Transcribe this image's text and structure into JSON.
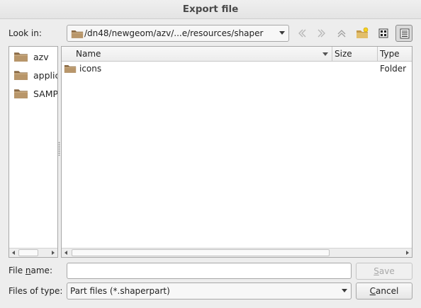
{
  "window": {
    "title": "Export file"
  },
  "look_in": {
    "label": "Look in:",
    "path": "/dn48/newgeom/azv/...e/resources/shaper"
  },
  "toolbar": {
    "icons": [
      "back-icon",
      "forward-icon",
      "parent-directory-icon",
      "new-folder-icon",
      "list-view-icon",
      "detail-view-icon"
    ],
    "active_view": "detail-view"
  },
  "sidebar": {
    "items": [
      {
        "label": "azv"
      },
      {
        "label": "applic"
      },
      {
        "label": "SAMPI"
      }
    ]
  },
  "file_list": {
    "columns": [
      "Name",
      "Size",
      "Type"
    ],
    "rows": [
      {
        "name": "icons",
        "size": "",
        "type": "Folder"
      }
    ]
  },
  "file_name": {
    "label_pre": "File ",
    "label_mnemonic": "n",
    "label_post": "ame:",
    "value": ""
  },
  "files_of_type": {
    "label": "Files of type:",
    "value": "Part files (*.shaperpart)"
  },
  "buttons": {
    "save": {
      "mnemonic": "S",
      "rest": "ave"
    },
    "cancel": {
      "mnemonic": "C",
      "rest": "ancel"
    }
  },
  "colors": {
    "folder": "#a4835a",
    "panel_bg": "#ffffff",
    "dialog_bg": "#ededed"
  }
}
